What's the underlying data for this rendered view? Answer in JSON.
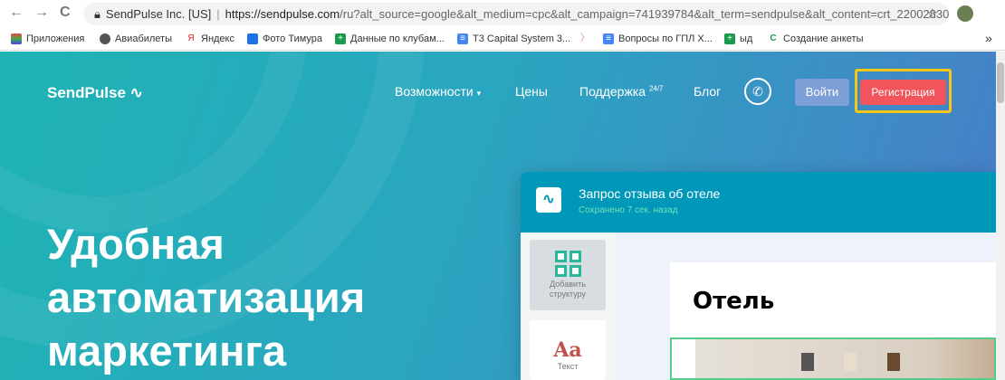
{
  "browser": {
    "back": "←",
    "forward": "→",
    "reload": "C",
    "site_name": "SendPulse Inc. [US]",
    "url_host": "https://sendpulse.com",
    "url_rest": "/ru?alt_source=google&alt_medium=cpc&alt_campaign=741939784&alt_term=sendpulse&alt_content=crt_220028307...",
    "star": "☆"
  },
  "bookmarks": [
    "Приложения",
    "Авиабилеты",
    "Яндекс",
    "Фото Тимура",
    "Данные по клубам...",
    "T3 Capital System 3...",
    "",
    "Вопросы по ГПЛ Х...",
    "ыд",
    "Создание анкеты"
  ],
  "bookmarks_more": "»",
  "nav": {
    "logo": "SendPulse",
    "features": "Возможности",
    "prices": "Цены",
    "support": "Поддержка",
    "support_sup": "24/7",
    "blog": "Блог",
    "phone": "✆",
    "login": "Войти",
    "register": "Регистрация"
  },
  "hero": {
    "line1": "Удобная",
    "line2": "автоматизация",
    "line3": "маркетинга"
  },
  "editor": {
    "title": "Запрос отзыва об отеле",
    "saved": "Сохранено 7 сек. назад",
    "add_structure": "Добавить структуру",
    "text_icon": "Aa",
    "text_label": "Текст",
    "card_title": "Отель"
  }
}
